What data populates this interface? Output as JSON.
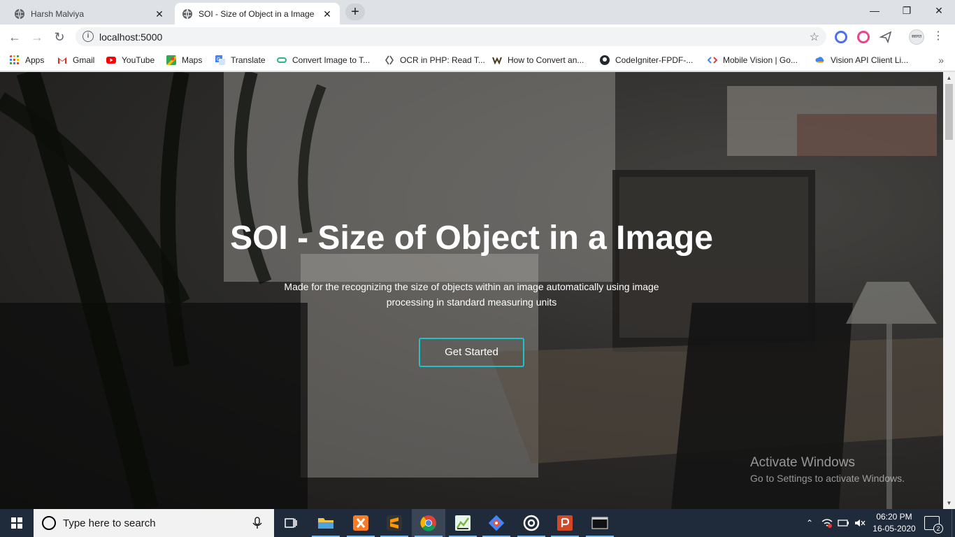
{
  "browser": {
    "tabs": [
      {
        "title": "Harsh Malviya",
        "active": false
      },
      {
        "title": "SOI - Size of Object in a Image",
        "active": true
      }
    ],
    "new_tab": "+",
    "window_controls": {
      "minimize": "—",
      "restore": "❐",
      "close": "✕"
    },
    "nav": {
      "back": "←",
      "forward": "→",
      "reload": "↻"
    },
    "address": {
      "url": "localhost:5000",
      "info_icon": "i",
      "star": "☆"
    },
    "profile_text": "स्वागत",
    "menu": "⋮",
    "bookmarks": [
      {
        "label": "Apps",
        "icon_color": "#e8453c"
      },
      {
        "label": "Gmail",
        "icon_color": "#d93025"
      },
      {
        "label": "YouTube",
        "icon_color": "#ff0000"
      },
      {
        "label": "Maps",
        "icon_color": "#34a853"
      },
      {
        "label": "Translate",
        "icon_color": "#4285f4"
      },
      {
        "label": "Convert Image to T...",
        "icon_color": "#2eb67d"
      },
      {
        "label": "OCR in PHP: Read T...",
        "icon_color": "#555555"
      },
      {
        "label": "How to Convert an...",
        "icon_color": "#4a3c1c"
      },
      {
        "label": "CodeIgniter-FPDF-...",
        "icon_color": "#24292e"
      },
      {
        "label": "Mobile Vision  |  Go...",
        "icon_color": "#e53935"
      },
      {
        "label": "Vision API Client Li...",
        "icon_color": "#fbbc04"
      }
    ],
    "bookmarks_more": "»"
  },
  "page": {
    "title": "SOI - Size of Object in a Image",
    "subtitle": "Made for the recognizing the size of objects within an image automatically using image processing in standard measuring units",
    "cta_label": "Get Started",
    "accent_color": "#20c2c8"
  },
  "watermark": {
    "line1": "Activate Windows",
    "line2": "Go to Settings to activate Windows."
  },
  "taskbar": {
    "search_placeholder": "Type here to search",
    "apps": [
      {
        "name": "task-view",
        "color": "#ffffff"
      },
      {
        "name": "file-explorer",
        "color": "#f4c542"
      },
      {
        "name": "xampp",
        "color": "#fb7a24"
      },
      {
        "name": "sublime-text",
        "color": "#ff9800"
      },
      {
        "name": "chrome",
        "color": "#4285f4"
      },
      {
        "name": "chart-app",
        "color": "#7cb342"
      },
      {
        "name": "git",
        "color": "#f05032"
      },
      {
        "name": "target-app",
        "color": "#ffffff"
      },
      {
        "name": "powerpoint",
        "color": "#d24726"
      },
      {
        "name": "terminal",
        "color": "#cccccc"
      }
    ],
    "time": "06:20 PM",
    "date": "16-05-2020",
    "notification_count": "2"
  }
}
